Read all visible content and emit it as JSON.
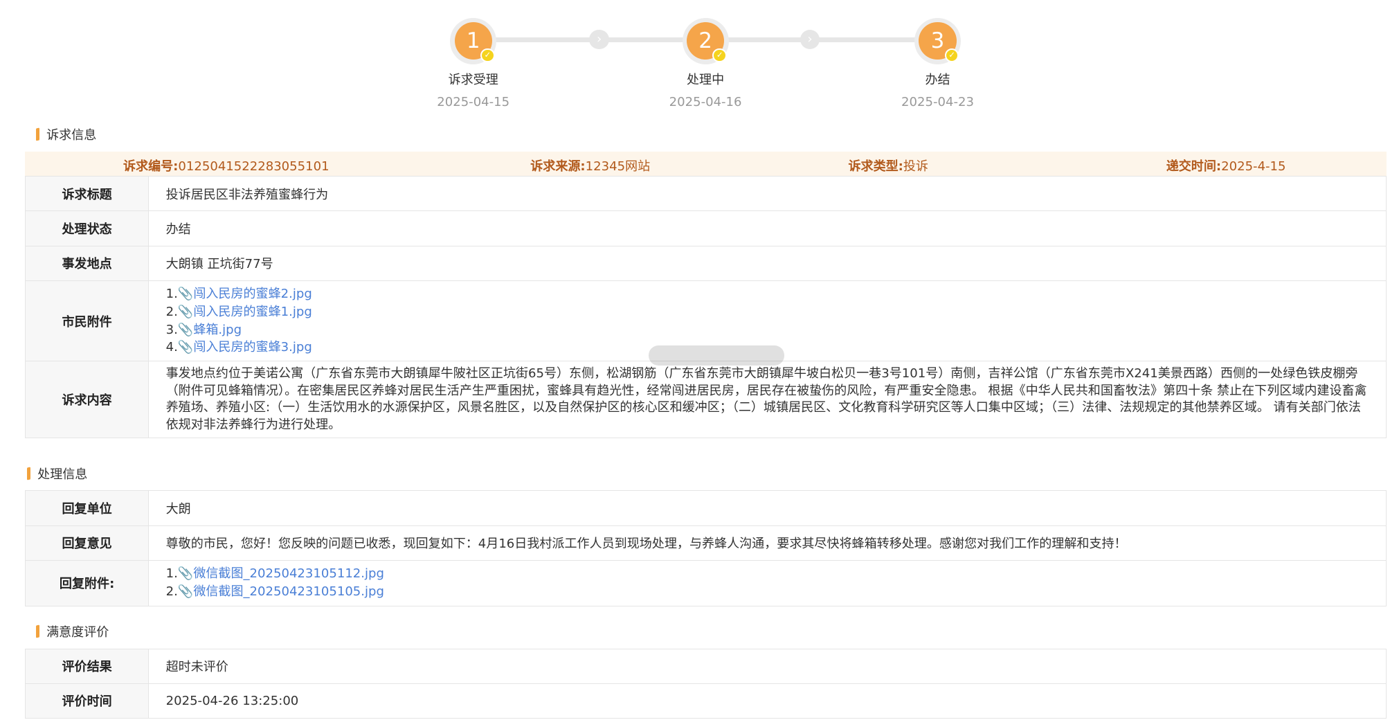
{
  "steps": [
    {
      "number": "1",
      "label": "诉求受理",
      "date": "2025-04-15"
    },
    {
      "number": "2",
      "label": "处理中",
      "date": "2025-04-16"
    },
    {
      "number": "3",
      "label": "办结",
      "date": "2025-04-23"
    }
  ],
  "section_request": {
    "title": "诉求信息"
  },
  "meta": {
    "id_key": "诉求编号:",
    "id_val": "0125041522283055101",
    "source_key": "诉求来源:",
    "source_val": "12345网站",
    "type_key": "诉求类型:",
    "type_val": "投诉",
    "time_key": "递交时间:",
    "time_val": "2025-4-15"
  },
  "request": {
    "title_key": "诉求标题",
    "title_val": "投诉居民区非法养殖蜜蜂行为",
    "status_key": "处理状态",
    "status_val": "办结",
    "location_key": "事发地点",
    "location_val": "大朗镇 正坑街77号",
    "attach_key": "市民附件",
    "attachments": [
      {
        "num": "1.",
        "name": "闯入民房的蜜蜂2.jpg"
      },
      {
        "num": "2.",
        "name": "闯入民房的蜜蜂1.jpg"
      },
      {
        "num": "3.",
        "name": "蜂箱.jpg"
      },
      {
        "num": "4.",
        "name": "闯入民房的蜜蜂3.jpg"
      }
    ],
    "content_key": "诉求内容",
    "content_val": "事发地点约位于美诺公寓（广东省东莞市大朗镇犀牛陂社区正坑街65号）东侧，松湖钢筋（广东省东莞市大朗镇犀牛坡白松贝一巷3号101号）南侧，吉祥公馆（广东省东莞市X241美景西路）西侧的一处绿色铁皮棚旁（附件可见蜂箱情况）。在密集居民区养蜂对居民生活产生严重困扰，蜜蜂具有趋光性，经常闯进居民房，居民存在被蛰伤的风险，有严重安全隐患。 根据《中华人民共和国畜牧法》第四十条 禁止在下列区域内建设畜禽养殖场、养殖小区:（一）生活饮用水的水源保护区，风景名胜区，以及自然保护区的核心区和缓冲区；（二）城镇居民区、文化教育科学研究区等人口集中区域；（三）法律、法规规定的其他禁养区域。 请有关部门依法依规对非法养蜂行为进行处理。"
  },
  "section_handle": {
    "title": "处理信息"
  },
  "handle": {
    "unit_key": "回复单位",
    "unit_val": "大朗",
    "opinion_key": "回复意见",
    "opinion_val": "尊敬的市民，您好！您反映的问题已收悉，现回复如下：4月16日我村派工作人员到现场处理，与养蜂人沟通，要求其尽快将蜂箱转移处理。感谢您对我们工作的理解和支持！",
    "attach_key": "回复附件:",
    "attachments": [
      {
        "num": "1.",
        "name": "微信截图_20250423105112.jpg"
      },
      {
        "num": "2.",
        "name": "微信截图_20250423105105.jpg"
      }
    ]
  },
  "section_eval": {
    "title": "满意度评价"
  },
  "eval": {
    "result_key": "评价结果",
    "result_val": "超时未评价",
    "time_key": "评价时间",
    "time_val": "2025-04-26 13:25:00"
  },
  "colors": {
    "accent": "#f5a54a",
    "check": "#f5d31e",
    "meta_text": "#b25a1c",
    "link": "#4a7fd6"
  },
  "icons": {
    "attachment": "paperclip-icon",
    "step_done": "check-icon",
    "step_arrow": "chevron-right-icon"
  }
}
